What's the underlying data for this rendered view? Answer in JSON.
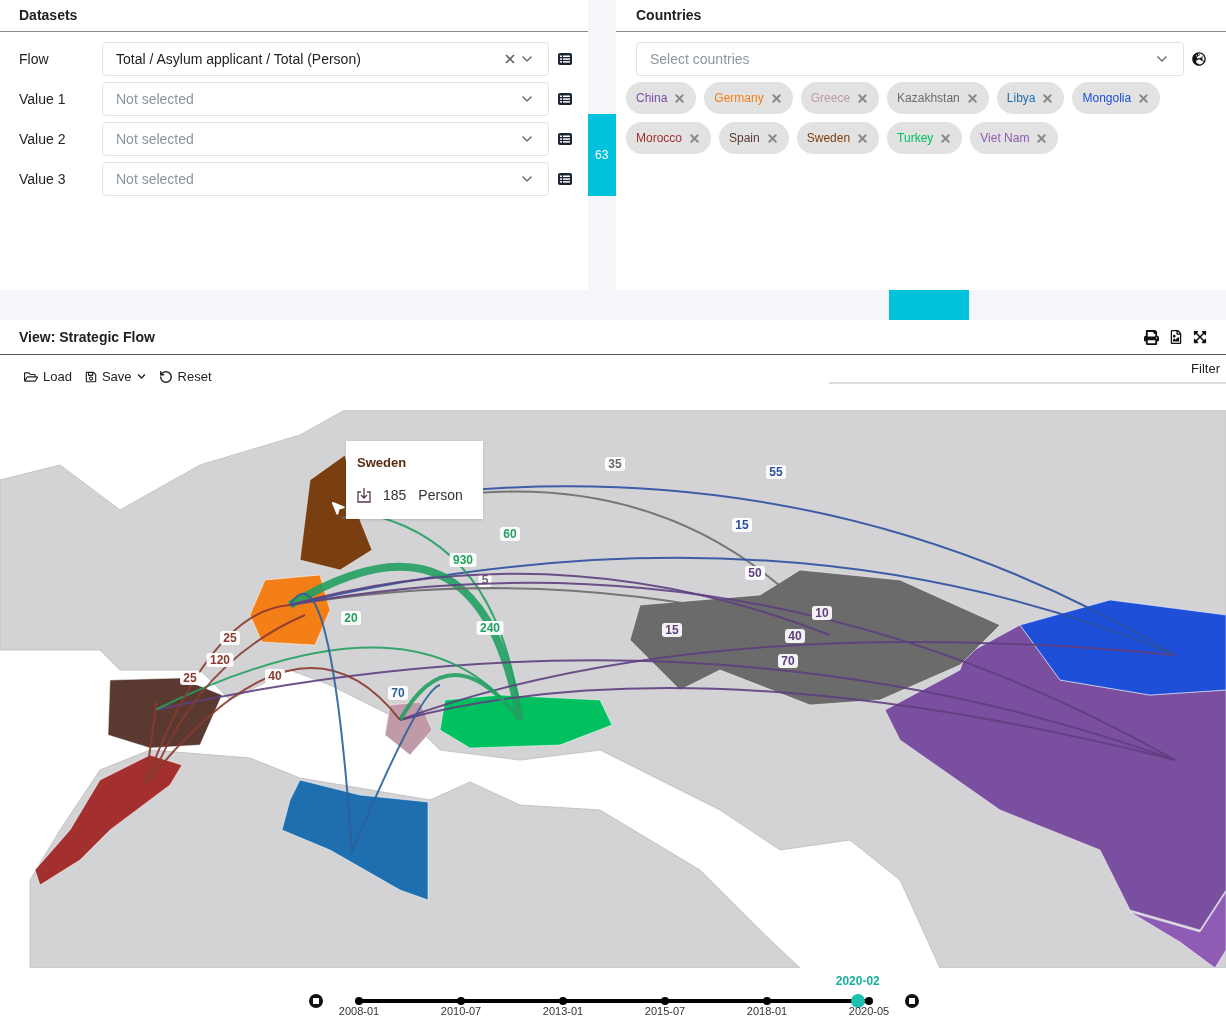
{
  "datasets": {
    "title": "Datasets",
    "rows": [
      {
        "label": "Flow",
        "value": "Total / Asylum applicant / Total (Person)"
      },
      {
        "label": "Value 1",
        "placeholder": "Not selected"
      },
      {
        "label": "Value 2",
        "placeholder": "Not selected"
      },
      {
        "label": "Value 3",
        "placeholder": "Not selected"
      }
    ]
  },
  "side_tab": {
    "label": "63"
  },
  "countries": {
    "title": "Countries",
    "placeholder": "Select countries",
    "tags": [
      {
        "label": "China",
        "color": "#7b4fa0"
      },
      {
        "label": "Germany",
        "color": "#f57f17"
      },
      {
        "label": "Greece",
        "color": "#c09aa8"
      },
      {
        "label": "Kazakhstan",
        "color": "#6b6b6b"
      },
      {
        "label": "Libya",
        "color": "#1f6fb0"
      },
      {
        "label": "Mongolia",
        "color": "#1e4fd8"
      },
      {
        "label": "Morocco",
        "color": "#a3302e"
      },
      {
        "label": "Spain",
        "color": "#5a3a30"
      },
      {
        "label": "Sweden",
        "color": "#7a3f10"
      },
      {
        "label": "Turkey",
        "color": "#00c060"
      },
      {
        "label": "Viet Nam",
        "color": "#8e5bb5"
      }
    ]
  },
  "view": {
    "title": "View: Strategic Flow",
    "toolbar": [
      {
        "kind": "load",
        "label": "Load"
      },
      {
        "kind": "save",
        "label": "Save"
      },
      {
        "kind": "reset",
        "label": "Reset"
      }
    ],
    "filter": "Filter"
  },
  "map": {
    "flows": [
      {
        "label": "35",
        "color": "#6b6b6b"
      },
      {
        "label": "55",
        "color": "#2b4fa0"
      },
      {
        "label": "15",
        "color": "#2b4fa0"
      },
      {
        "label": "60",
        "color": "#22a060"
      },
      {
        "label": "930",
        "color": "#22a060"
      },
      {
        "label": "5",
        "color": "#6b6b6b"
      },
      {
        "label": "50",
        "color": "#5e3f80"
      },
      {
        "label": "10",
        "color": "#5e3f80"
      },
      {
        "label": "15",
        "color": "#5e3f80"
      },
      {
        "label": "40",
        "color": "#5e3f80"
      },
      {
        "label": "70",
        "color": "#5e3f80"
      },
      {
        "label": "20",
        "color": "#22a060"
      },
      {
        "label": "240",
        "color": "#22a060"
      },
      {
        "label": "25",
        "color": "#8a3a30"
      },
      {
        "label": "120",
        "color": "#8a3a30"
      },
      {
        "label": "25",
        "color": "#8a3a30"
      },
      {
        "label": "40",
        "color": "#8a3a30"
      },
      {
        "label": "70",
        "color": "#2b5f9a"
      }
    ],
    "tooltip": {
      "title": "Sweden",
      "value": "185",
      "unit": "Person"
    }
  },
  "timeline": {
    "current": "2020-02",
    "level": 0.978,
    "ticks": [
      "2008-01",
      "2010-07",
      "2013-01",
      "2015-07",
      "2018-01",
      "2020-05"
    ]
  }
}
